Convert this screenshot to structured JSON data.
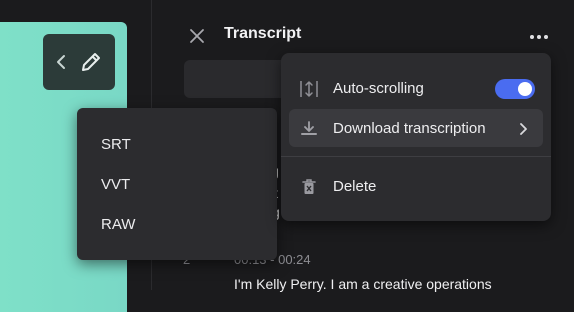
{
  "header": {
    "title": "Transcript"
  },
  "format_menu": {
    "items": [
      "SRT",
      "VVT",
      "RAW"
    ]
  },
  "actions_menu": {
    "auto_scrolling": {
      "label": "Auto-scrolling",
      "enabled": true
    },
    "download": {
      "label": "Download transcription"
    },
    "delete": {
      "label": "Delete"
    }
  },
  "transcript": {
    "segment_number": "2",
    "segment_time": "00:13 - 00:24",
    "segment_text": "I'm Kelly Perry. I am a creative operations",
    "fragments": [
      "g",
      "t",
      "g"
    ]
  },
  "colors": {
    "accent": "#4a6cf0",
    "card": "#7fe0c8",
    "bg": "#1b1b1d",
    "menu": "#2c2c2f"
  }
}
